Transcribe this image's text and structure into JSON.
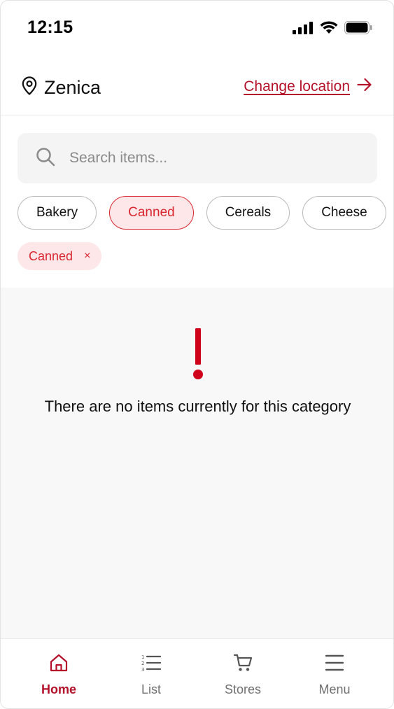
{
  "status_bar": {
    "time": "12:15",
    "icons": [
      "cellular-signal-icon",
      "wifi-icon",
      "battery-icon"
    ]
  },
  "location": {
    "icon": "map-pin-icon",
    "city": "Zenica",
    "change_label": "Change location",
    "change_icon": "arrow-right-icon"
  },
  "search": {
    "icon": "search-icon",
    "placeholder": "Search items...",
    "value": ""
  },
  "categories": [
    {
      "label": "Bakery",
      "active": false
    },
    {
      "label": "Canned",
      "active": true
    },
    {
      "label": "Cereals",
      "active": false
    },
    {
      "label": "Cheese",
      "active": false
    }
  ],
  "active_filter": {
    "label": "Canned",
    "remove_symbol": "×"
  },
  "empty_state": {
    "icon": "exclamation-icon",
    "message": "There are no items currently for this category"
  },
  "bottom_nav": {
    "items": [
      {
        "label": "Home",
        "icon": "home-icon",
        "active": true
      },
      {
        "label": "List",
        "icon": "numbered-list-icon",
        "active": false
      },
      {
        "label": "Stores",
        "icon": "cart-icon",
        "active": false
      },
      {
        "label": "Menu",
        "icon": "hamburger-menu-icon",
        "active": false
      }
    ]
  },
  "colors": {
    "accent": "#b3122a",
    "chip_active_bg": "#fde7e8",
    "chip_active_text": "#d9262f",
    "empty_icon": "#d0021b",
    "content_bg": "#f8f8f8"
  }
}
